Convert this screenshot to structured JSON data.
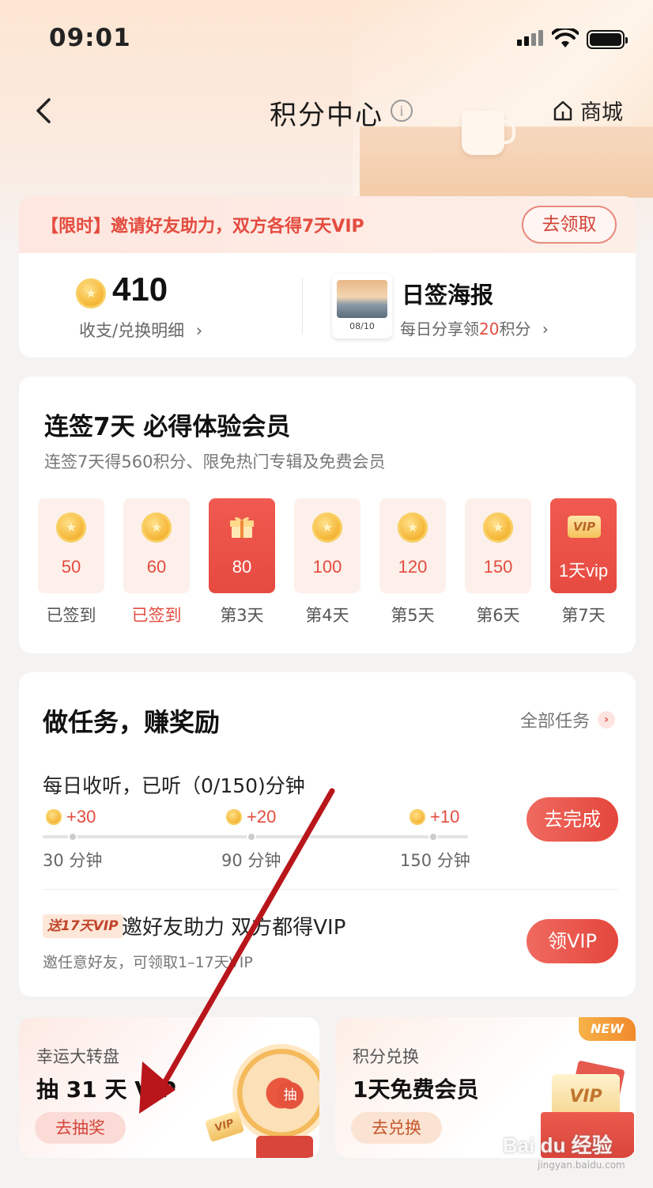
{
  "status_bar": {
    "time": "09:01"
  },
  "nav": {
    "title": "积分中心",
    "info_icon": "i",
    "shop_label": "商城"
  },
  "promo": {
    "text": "【限时】邀请好友助力，双方各得7天VIP",
    "button": "去领取"
  },
  "points": {
    "value": "410",
    "detail_link": "收支/兑换明细"
  },
  "poster": {
    "date": "08/10",
    "title": "日签海报",
    "sub_prefix": "每日分享领",
    "sub_amount": "20",
    "sub_suffix": "积分"
  },
  "sign_in": {
    "title": "连签7天 必得体验会员",
    "subtitle": "连签7天得560积分、限免热门专辑及免费会员",
    "days": [
      {
        "value": "50",
        "label": "已签到",
        "icon": "coin-icon",
        "state": "signed"
      },
      {
        "value": "60",
        "label": "已签到",
        "icon": "coin-icon",
        "state": "today-signed"
      },
      {
        "value": "80",
        "label": "第3天",
        "icon": "gift-icon",
        "state": "highlight"
      },
      {
        "value": "100",
        "label": "第4天",
        "icon": "coin-icon",
        "state": "pending"
      },
      {
        "value": "120",
        "label": "第5天",
        "icon": "coin-icon",
        "state": "pending"
      },
      {
        "value": "150",
        "label": "第6天",
        "icon": "coin-icon",
        "state": "pending"
      },
      {
        "value": "1天vip",
        "label": "第7天",
        "icon": "vip-icon",
        "icon_text": "VIP",
        "state": "highlight"
      }
    ]
  },
  "tasks": {
    "title": "做任务，赚奖励",
    "all_link": "全部任务",
    "listen": {
      "title": "每日收听，已听（0/150)分钟",
      "rewards": [
        "+30",
        "+20",
        "+10"
      ],
      "ticks": [
        "30 分钟",
        "90 分钟",
        "150 分钟"
      ],
      "progress": 0,
      "button": "去完成"
    },
    "invite": {
      "tag": "送17天VIP",
      "title": "邀好友助力 双方都得VIP",
      "subtitle": "邀任意好友，可领取1–17天VIP",
      "button": "领VIP"
    }
  },
  "lottery": {
    "small": "幸运大转盘",
    "big": "抽 31 天 VIP",
    "button": "去抽奖",
    "wheel_text": "抽",
    "card_text": "VIP"
  },
  "exchange": {
    "badge": "NEW",
    "small": "积分兑换",
    "big": "1天免费会员",
    "button": "去兑换",
    "card_text": "VIP"
  },
  "watermark": {
    "text": "Bai du 经验",
    "sub": "jingyan.baidu.com"
  },
  "colors": {
    "accent": "#e44b3f",
    "annotation_arrow": "#b8161b"
  }
}
